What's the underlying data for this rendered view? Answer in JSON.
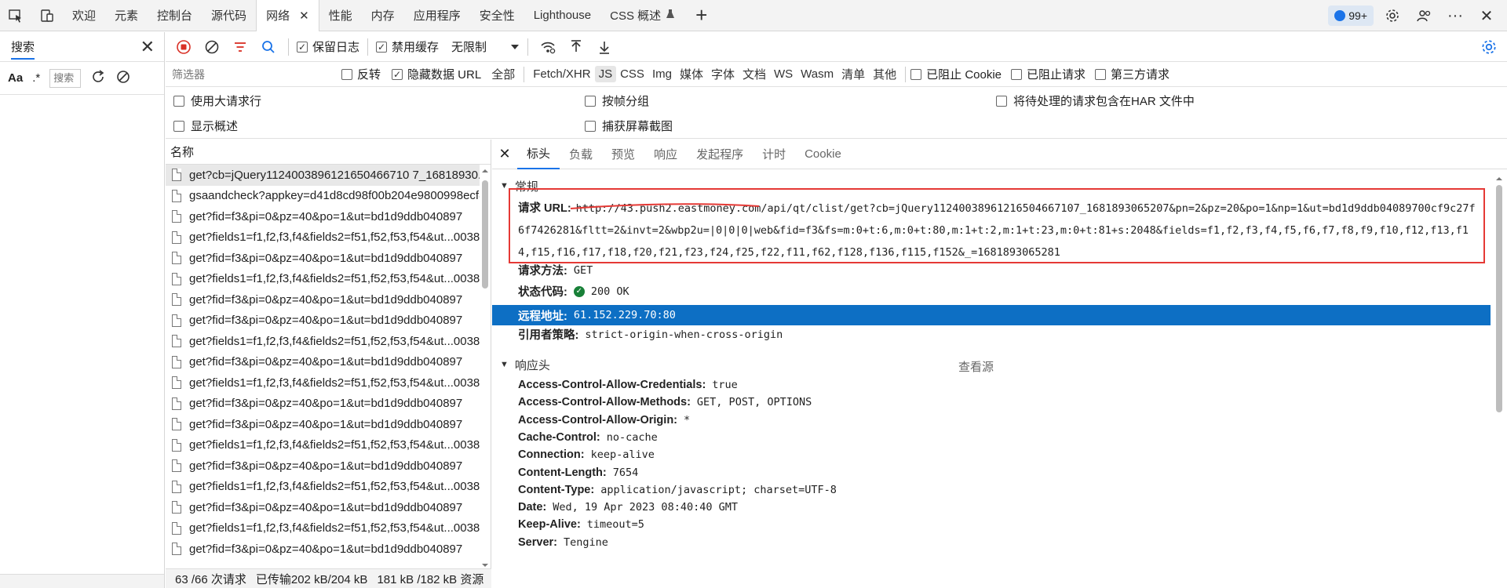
{
  "tabbar": {
    "tabs": [
      {
        "label": "欢迎"
      },
      {
        "label": "元素"
      },
      {
        "label": "控制台"
      },
      {
        "label": "源代码"
      },
      {
        "label": "网络",
        "active": true
      },
      {
        "label": "性能"
      },
      {
        "label": "内存"
      },
      {
        "label": "应用程序"
      },
      {
        "label": "安全性"
      },
      {
        "label": "Lighthouse"
      },
      {
        "label": "CSS 概述"
      }
    ],
    "close_glyph": "✕",
    "plus_glyph": "+",
    "issues_count": "99+",
    "more_glyph": "···"
  },
  "search": {
    "title": "搜索",
    "close_glyph": "✕",
    "match_case": "Aa",
    "regex": ".*",
    "input_placeholder": "搜索"
  },
  "toolbar": {
    "preserve_log": "保留日志",
    "disable_cache": "禁用缓存",
    "throttling": "无限制"
  },
  "filter": {
    "placeholder": "筛选器",
    "invert": "反转",
    "hide_data_urls": "隐藏数据 URL",
    "all": "全部",
    "types": [
      "Fetch/XHR",
      "JS",
      "CSS",
      "Img",
      "媒体",
      "字体",
      "文档",
      "WS",
      "Wasm",
      "清单",
      "其他"
    ],
    "active_type": "JS",
    "blocked_cookies": "已阻止 Cookie",
    "blocked_requests": "已阻止请求",
    "third_party": "第三方请求"
  },
  "options": {
    "large_rows": "使用大请求行",
    "group_by_frame": "按帧分组",
    "har_pending": "将待处理的请求包含在HAR 文件中",
    "show_overview": "显示概述",
    "capture_screenshots": "捕获屏幕截图"
  },
  "request_list": {
    "header": "名称",
    "rows": [
      "get?cb=jQuery1124003896121650466710 7_16818930...",
      "gsaandcheck?appkey=d41d8cd98f00b204e9800998ecf8",
      "get?fid=f3&pi=0&pz=40&po=1&ut=bd1d9ddb040897",
      "get?fields1=f1,f2,f3,f4&fields2=f51,f52,f53,f54&ut...0038",
      "get?fid=f3&pi=0&pz=40&po=1&ut=bd1d9ddb040897",
      "get?fields1=f1,f2,f3,f4&fields2=f51,f52,f53,f54&ut...0038",
      "get?fid=f3&pi=0&pz=40&po=1&ut=bd1d9ddb040897",
      "get?fid=f3&pi=0&pz=40&po=1&ut=bd1d9ddb040897",
      "get?fields1=f1,f2,f3,f4&fields2=f51,f52,f53,f54&ut...0038",
      "get?fid=f3&pi=0&pz=40&po=1&ut=bd1d9ddb040897",
      "get?fields1=f1,f2,f3,f4&fields2=f51,f52,f53,f54&ut...0038",
      "get?fid=f3&pi=0&pz=40&po=1&ut=bd1d9ddb040897",
      "get?fid=f3&pi=0&pz=40&po=1&ut=bd1d9ddb040897",
      "get?fields1=f1,f2,f3,f4&fields2=f51,f52,f53,f54&ut...0038",
      "get?fid=f3&pi=0&pz=40&po=1&ut=bd1d9ddb040897",
      "get?fields1=f1,f2,f3,f4&fields2=f51,f52,f53,f54&ut...0038",
      "get?fid=f3&pi=0&pz=40&po=1&ut=bd1d9ddb040897",
      "get?fields1=f1,f2,f3,f4&fields2=f51,f52,f53,f54&ut...0038",
      "get?fid=f3&pi=0&pz=40&po=1&ut=bd1d9ddb040897"
    ]
  },
  "status": {
    "requests": "63 /66 次请求",
    "transferred": "已传输202 kB/204 kB",
    "resources": "181 kB /182 kB 资源"
  },
  "details": {
    "tabs": [
      "标头",
      "负载",
      "预览",
      "响应",
      "发起程序",
      "计时",
      "Cookie"
    ],
    "active_tab": "标头",
    "general_title": "常规",
    "request_url_label": "请求 URL:",
    "request_url": "http://43.push2.eastmoney.com/api/qt/clist/get?cb=jQuery11240038961216504667107_1681893065207&pn=2&pz=20&po=1&np=1&ut=bd1d9ddb04089700cf9c27f6f7426281&fltt=2&invt=2&wbp2u=|0|0|0|web&fid=f3&fs=m:0+t:6,m:0+t:80,m:1+t:2,m:1+t:23,m:0+t:81+s:2048&fields=f1,f2,f3,f4,f5,f6,f7,f8,f9,f10,f12,f13,f14,f15,f16,f17,f18,f20,f21,f23,f24,f25,f22,f11,f62,f128,f136,f115,f152&_=1681893065281",
    "method_label": "请求方法:",
    "method": "GET",
    "status_label": "状态代码:",
    "status": "200 OK",
    "remote_label": "远程地址:",
    "remote": "61.152.229.70:80",
    "referrer_label": "引用者策略:",
    "referrer": "strict-origin-when-cross-origin",
    "response_headers_title": "响应头",
    "view_source": "查看源",
    "headers": [
      {
        "k": "Access-Control-Allow-Credentials:",
        "v": "true"
      },
      {
        "k": "Access-Control-Allow-Methods:",
        "v": "GET, POST, OPTIONS"
      },
      {
        "k": "Access-Control-Allow-Origin:",
        "v": "*"
      },
      {
        "k": "Cache-Control:",
        "v": "no-cache"
      },
      {
        "k": "Connection:",
        "v": "keep-alive"
      },
      {
        "k": "Content-Length:",
        "v": "7654"
      },
      {
        "k": "Content-Type:",
        "v": "application/javascript; charset=UTF-8"
      },
      {
        "k": "Date:",
        "v": "Wed, 19 Apr 2023 08:40:40 GMT"
      },
      {
        "k": "Keep-Alive:",
        "v": "timeout=5"
      },
      {
        "k": "Server:",
        "v": "Tengine"
      }
    ]
  },
  "colors": {
    "accent": "#1a73e8",
    "selected_row": "#0d6fc4",
    "highlight_box": "#e53935",
    "status_ok": "#188038",
    "record": "#d93025"
  }
}
